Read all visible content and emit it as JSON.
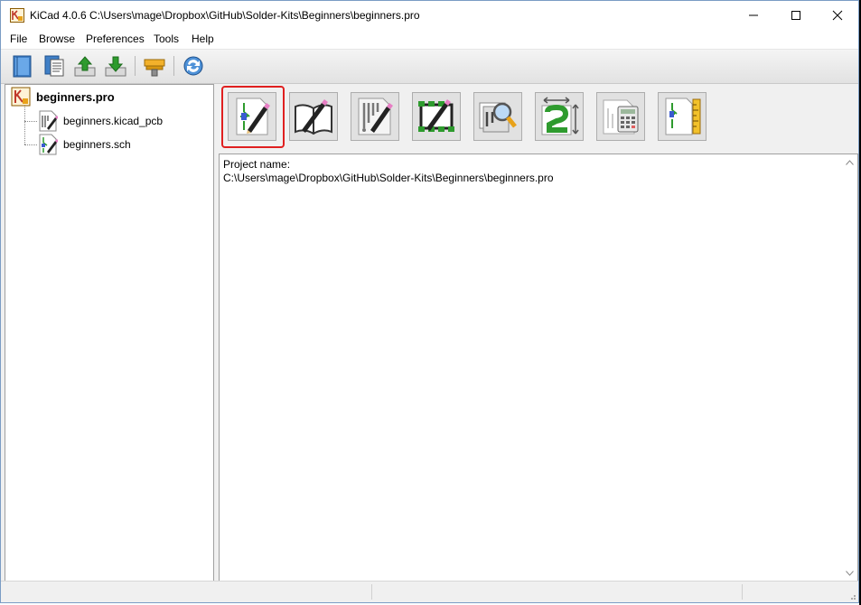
{
  "window": {
    "title": "KiCad 4.0.6 C:\\Users\\mage\\Dropbox\\GitHub\\Solder-Kits\\Beginners\\beginners.pro",
    "controls": [
      "minimize-icon",
      "maximize-icon",
      "close-icon"
    ]
  },
  "menu": {
    "items": [
      "File",
      "Browse",
      "Preferences",
      "Tools",
      "Help"
    ]
  },
  "toolbar": {
    "buttons": [
      "new-project-icon",
      "new-from-template-icon",
      "open-project-icon",
      "save-project-icon",
      "archive-project-icon",
      "refresh-icon"
    ]
  },
  "tree": {
    "root": {
      "label": "beginners.pro",
      "icon": "kicad-project-icon"
    },
    "children": [
      {
        "label": "beginners.kicad_pcb",
        "icon": "pcb-file-icon"
      },
      {
        "label": "beginners.sch",
        "icon": "schematic-file-icon"
      }
    ]
  },
  "launcher": {
    "buttons": [
      {
        "icon": "eeschema-icon",
        "highlighted": true
      },
      {
        "icon": "library-editor-icon"
      },
      {
        "icon": "pcbnew-icon"
      },
      {
        "icon": "footprint-editor-icon"
      },
      {
        "icon": "gerbview-icon"
      },
      {
        "icon": "bitmap2component-icon"
      },
      {
        "icon": "pcb-calculator-icon"
      },
      {
        "icon": "worksheet-editor-icon"
      }
    ]
  },
  "log": {
    "line1": "Project name:",
    "line2": "C:\\Users\\mage\\Dropbox\\GitHub\\Solder-Kits\\Beginners\\beginners.pro"
  },
  "colors": {
    "highlight": "#e02020",
    "accent_green": "#2e9b2e",
    "accent_orange": "#e8a21a"
  }
}
